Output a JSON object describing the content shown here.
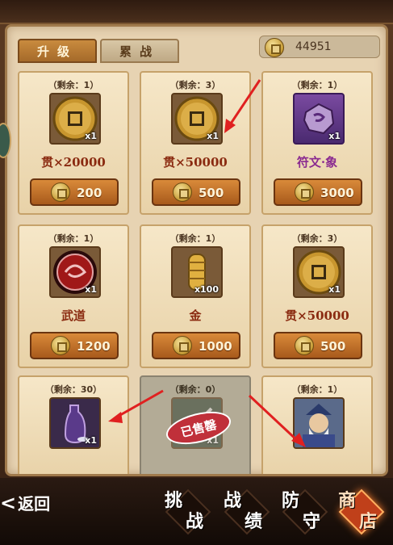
{
  "tabs": [
    {
      "label": "升级",
      "active": true
    },
    {
      "label": "累战",
      "active": false
    }
  ],
  "currency": {
    "amount": "44951",
    "icon": "coin-icon"
  },
  "items": [
    {
      "remain": "（剩余：1）",
      "name": "贯×20000",
      "qty": "x1",
      "price": "200",
      "icon": "copper-coin-icon"
    },
    {
      "remain": "（剩余：3）",
      "name": "贯×50000",
      "qty": "x1",
      "price": "500",
      "icon": "copper-coin-icon"
    },
    {
      "remain": "（剩余：1）",
      "name": "符文·象",
      "qty": "x1",
      "price": "3000",
      "icon": "rune-stone-icon"
    },
    {
      "remain": "（剩余：1）",
      "name": "武道",
      "qty": "x1",
      "price": "1200",
      "icon": "martial-emblem-icon"
    },
    {
      "remain": "（剩余：1）",
      "name": "金",
      "qty": "x100",
      "price": "1000",
      "icon": "gold-ingot-icon"
    },
    {
      "remain": "（剩余：3）",
      "name": "贯×50000",
      "qty": "x1",
      "price": "500",
      "icon": "copper-coin-icon"
    },
    {
      "remain": "（剩余：30）",
      "name": "",
      "qty": "x1",
      "price": "",
      "icon": "sake-bottle-icon"
    },
    {
      "remain": "（剩余：0）",
      "name": "",
      "qty": "x1",
      "price": "",
      "icon": "sword-icon",
      "sold_label": "已售罄"
    },
    {
      "remain": "（剩余：1）",
      "name": "",
      "qty": "",
      "price": "",
      "icon": "general-portrait-icon"
    }
  ],
  "bottom_nav": {
    "back": "返回",
    "buttons": [
      {
        "label_1": "挑",
        "label_2": "战",
        "active": false
      },
      {
        "label_1": "战",
        "label_2": "绩",
        "active": false
      },
      {
        "label_1": "防",
        "label_2": "守",
        "active": false
      },
      {
        "label_1": "商",
        "label_2": "店",
        "active": true
      }
    ]
  },
  "colors": {
    "accent_red": "#e02020",
    "button_orange": "#c97a34",
    "panel_bg": "#e7d3b2"
  }
}
